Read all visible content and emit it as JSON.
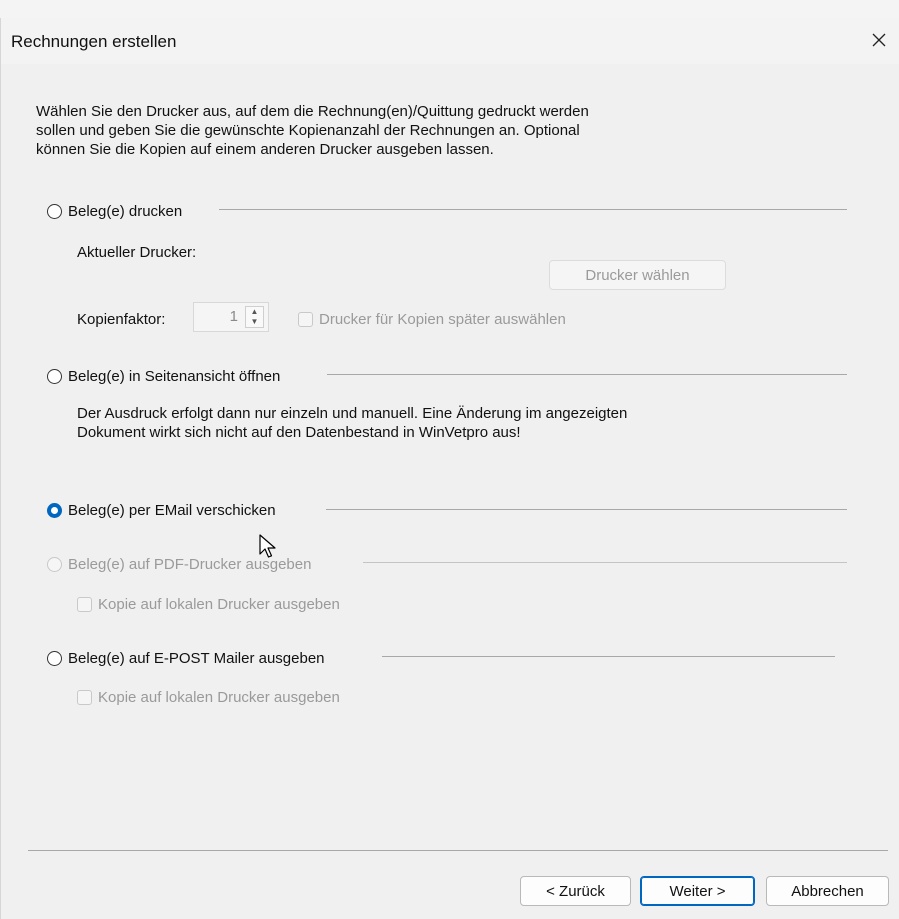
{
  "dialog": {
    "title": "Rechnungen erstellen",
    "intro_lines": [
      "Wählen Sie den Drucker aus, auf dem die Rechnung(en)/Quittung gedruckt werden",
      "sollen und geben Sie die gewünschte Kopienanzahl der Rechnungen an. Optional",
      "können Sie die Kopien auf einem anderen Drucker ausgeben lassen."
    ]
  },
  "print": {
    "option_label": "Beleg(e) drucken",
    "current_printer_label": "Aktueller Drucker:",
    "choose_printer_button": "Drucker wählen",
    "copies_label": "Kopienfaktor:",
    "copies_value": "1",
    "later_printer_checkbox": "Drucker für Kopien später auswählen"
  },
  "preview": {
    "option_label": "Beleg(e) in Seitenansicht öffnen",
    "note_lines": [
      "Der Ausdruck erfolgt dann nur einzeln und manuell. Eine Änderung im angezeigten",
      "Dokument wirkt sich nicht auf den Datenbestand in WinVetpro aus!"
    ]
  },
  "email": {
    "option_label": "Beleg(e) per EMail verschicken",
    "selected": true
  },
  "pdf": {
    "option_label": "Beleg(e) auf PDF-Drucker ausgeben",
    "copy_checkbox": "Kopie auf lokalen Drucker ausgeben"
  },
  "epost": {
    "option_label": "Beleg(e) auf E-POST Mailer ausgeben",
    "copy_checkbox": "Kopie auf lokalen Drucker ausgeben"
  },
  "footer": {
    "back_button": "< Zurück",
    "next_button": "Weiter >",
    "cancel_button": "Abbrechen"
  },
  "colors": {
    "accent": "#0067c0",
    "background": "#f0f0f0"
  }
}
